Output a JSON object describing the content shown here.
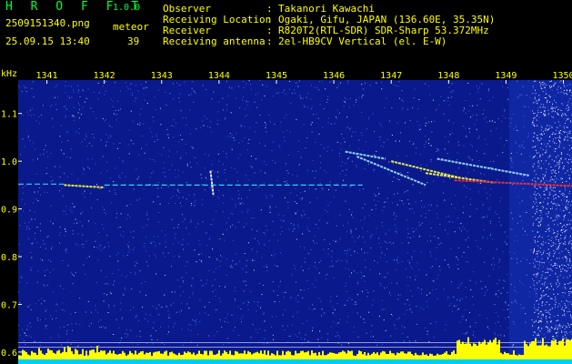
{
  "header": {
    "app_title": "H R O F F T",
    "version": "1.0.0",
    "filename": "2509151340.png",
    "datetime": "25.09.15 13:40",
    "meteor_label": "meteor",
    "meteor_count": "39",
    "info": [
      {
        "label": "Observer",
        "value": "Takanori Kawachi"
      },
      {
        "label": "Receiving Location",
        "value": "Ogaki, Gifu, JAPAN (136.60E, 35.35N)"
      },
      {
        "label": "Receiver",
        "value": "R820T2(RTL-SDR) SDR-Sharp 53.372MHz"
      },
      {
        "label": "Receiving antenna",
        "value": "2el-HB9CV Vertical (el. E-W)"
      }
    ],
    "colon": ":"
  },
  "colors": {
    "background": "#000000",
    "label_yellow": "#ffff00",
    "label_green": "#00ff33",
    "spectrogram_base": "#0a1a8c",
    "echo_cyan": "#40e0ff",
    "echo_yellow": "#ffff40",
    "echo_red": "#ff3030",
    "noise_bar": "#ffff00",
    "noise_base": "#00ccff"
  },
  "chart_data": {
    "type": "heatmap",
    "ylabel": "kHz",
    "x_ticks": [
      "1341",
      "1342",
      "1343",
      "1344",
      "1345",
      "1346",
      "1347",
      "1348",
      "1349",
      "1350"
    ],
    "x_range": [
      1340.5,
      1350.15
    ],
    "y_ticks": [
      "0.6",
      "0.7",
      "0.8",
      "0.9",
      "1.0",
      "1.1"
    ],
    "y_range": [
      0.575,
      1.17
    ],
    "carrier_frequency_khz": 0.95,
    "echoes": [
      {
        "t_start": 1340.5,
        "t_end": 1341.3,
        "f_start": 0.952,
        "f_end": 0.952,
        "kind": "carrier"
      },
      {
        "t_start": 1341.3,
        "t_end": 1342.0,
        "f_start": 0.95,
        "f_end": 0.945,
        "kind": "bright"
      },
      {
        "t_start": 1342.0,
        "t_end": 1346.5,
        "f_start": 0.95,
        "f_end": 0.95,
        "kind": "carrier"
      },
      {
        "t_start": 1343.85,
        "t_end": 1343.9,
        "f_start": 0.98,
        "f_end": 0.93,
        "kind": "burst"
      },
      {
        "t_start": 1346.2,
        "t_end": 1346.9,
        "f_start": 1.02,
        "f_end": 1.005,
        "kind": "trail"
      },
      {
        "t_start": 1346.4,
        "t_end": 1347.6,
        "f_start": 1.01,
        "f_end": 0.95,
        "kind": "trail"
      },
      {
        "t_start": 1347.0,
        "t_end": 1348.2,
        "f_start": 1.0,
        "f_end": 0.965,
        "kind": "bright"
      },
      {
        "t_start": 1347.6,
        "t_end": 1348.8,
        "f_start": 0.975,
        "f_end": 0.955,
        "kind": "bright"
      },
      {
        "t_start": 1347.8,
        "t_end": 1349.4,
        "f_start": 1.005,
        "f_end": 0.97,
        "kind": "trail"
      },
      {
        "t_start": 1348.1,
        "t_end": 1350.15,
        "f_start": 0.96,
        "f_end": 0.948,
        "kind": "hot"
      }
    ],
    "bottom_noise_bar": {
      "lower_khz": 0.61,
      "upper_khz": 0.62
    }
  }
}
